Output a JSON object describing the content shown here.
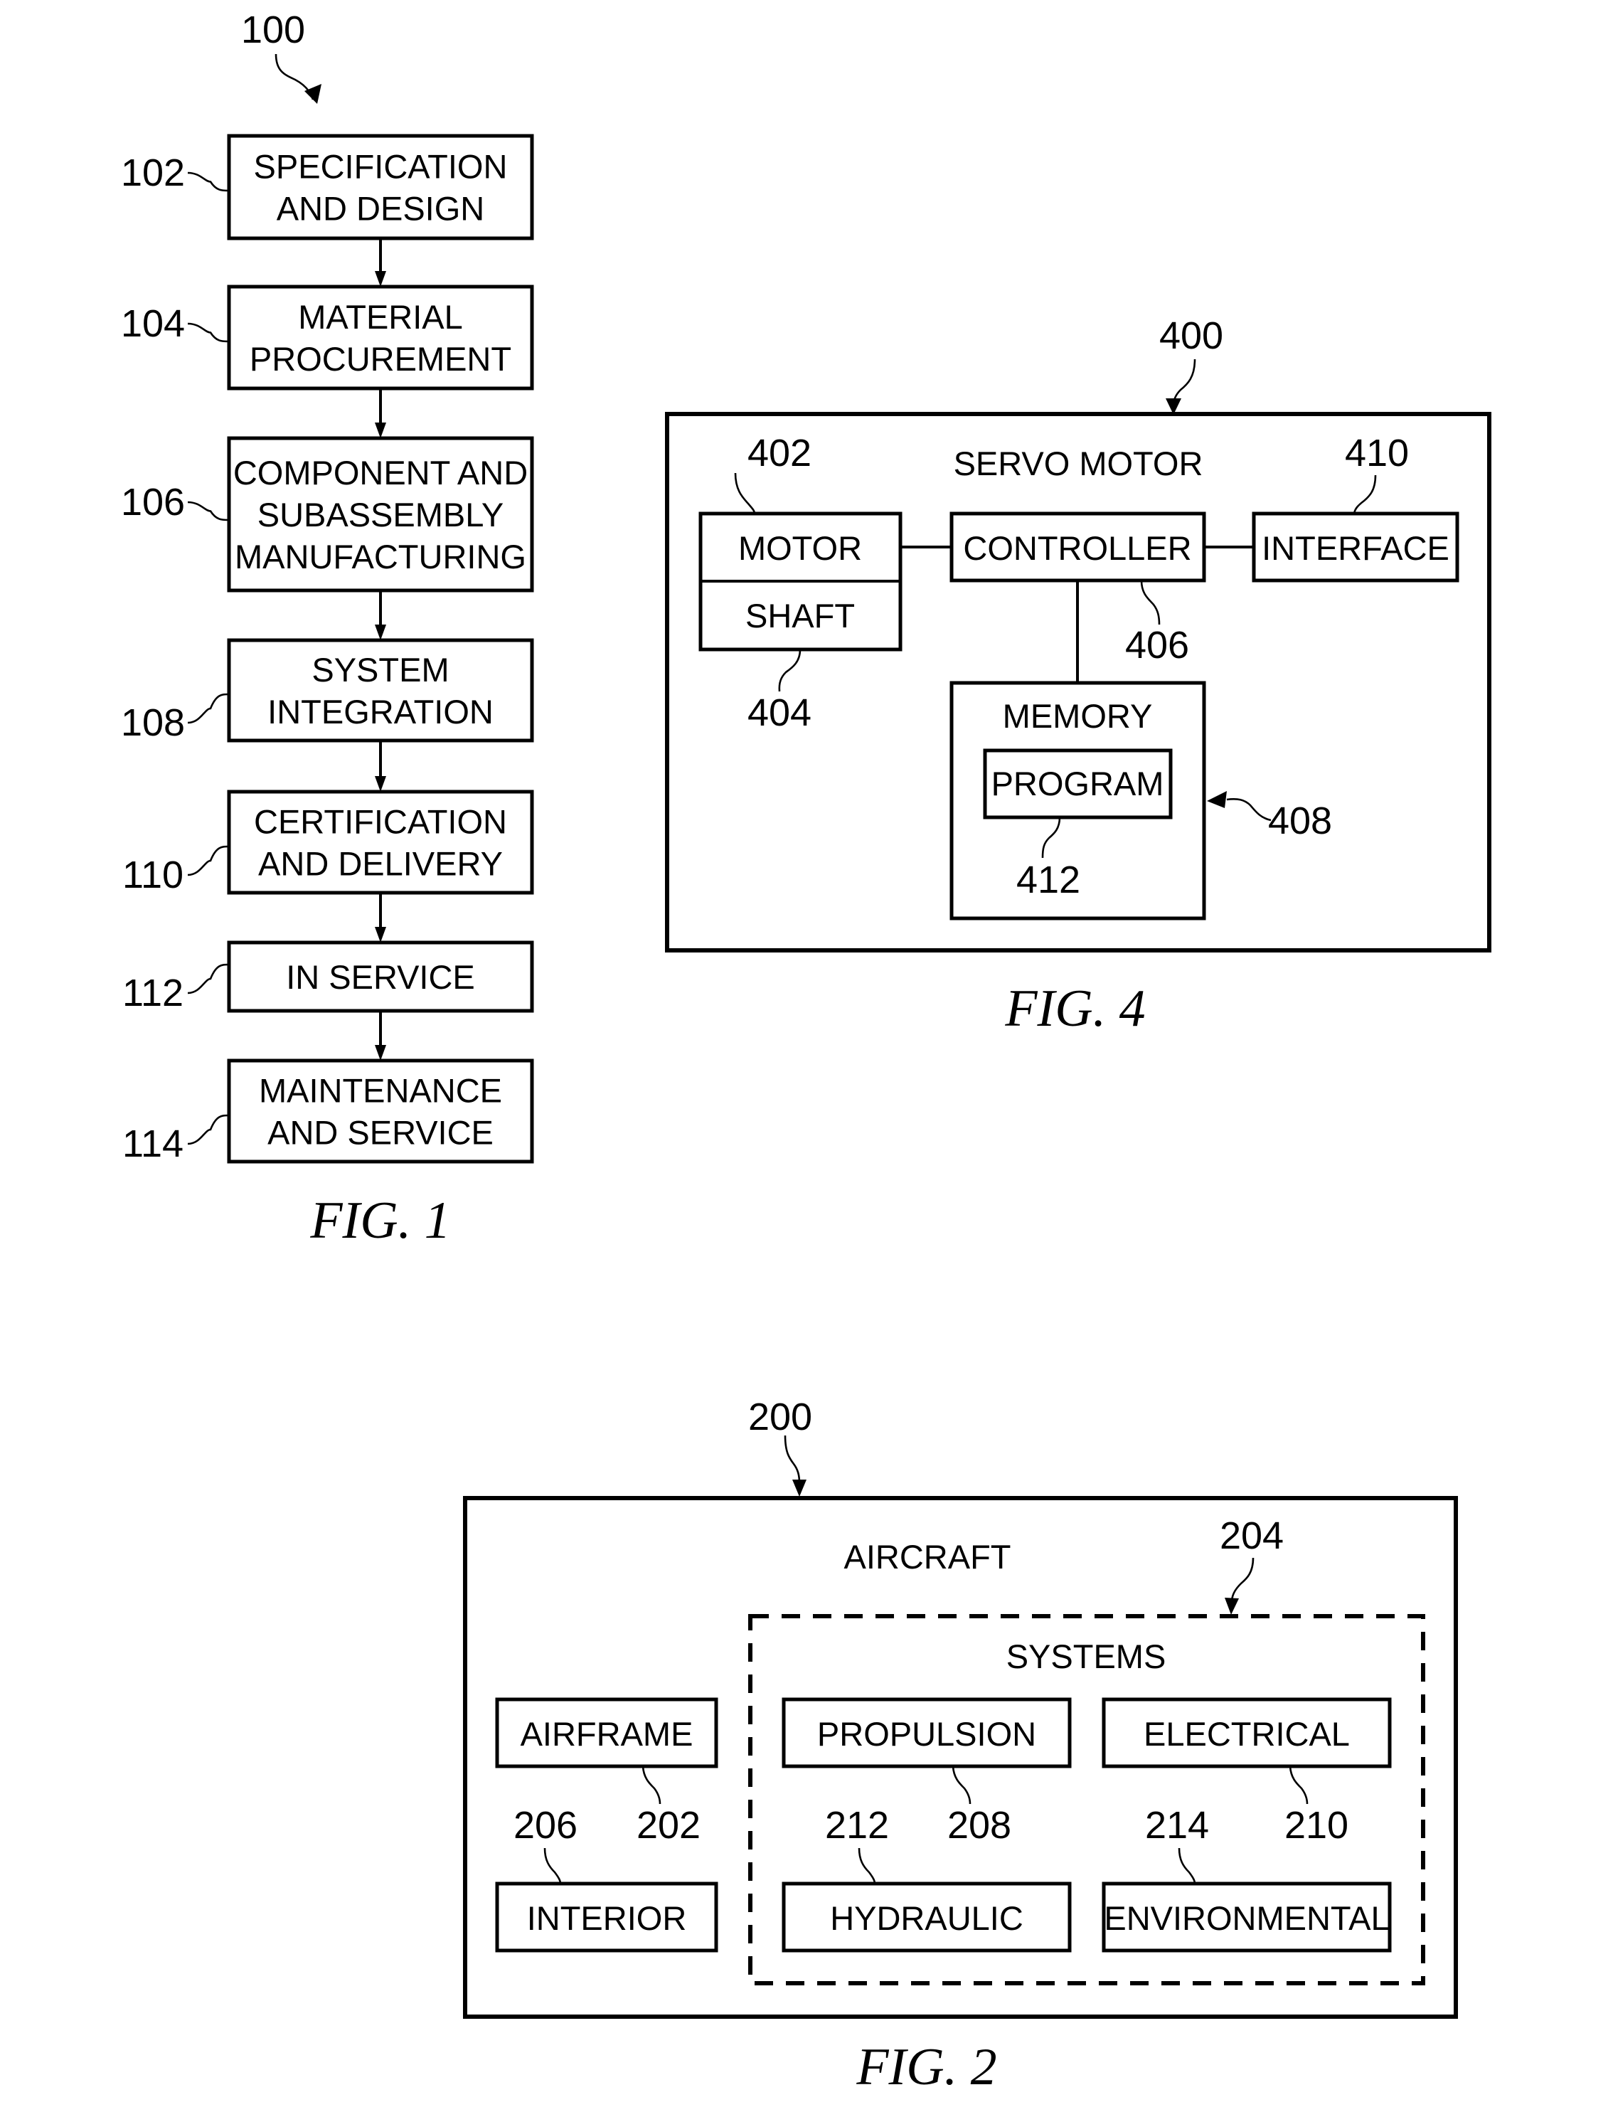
{
  "figures": {
    "fig1": {
      "caption": "FIG. 1",
      "ref": "100",
      "steps": [
        {
          "ref": "102",
          "lines": [
            "SPECIFICATION",
            "AND DESIGN"
          ]
        },
        {
          "ref": "104",
          "lines": [
            "MATERIAL",
            "PROCUREMENT"
          ]
        },
        {
          "ref": "106",
          "lines": [
            "COMPONENT AND",
            "SUBASSEMBLY",
            "MANUFACTURING"
          ]
        },
        {
          "ref": "108",
          "lines": [
            "SYSTEM",
            "INTEGRATION"
          ]
        },
        {
          "ref": "110",
          "lines": [
            "CERTIFICATION",
            "AND DELIVERY"
          ]
        },
        {
          "ref": "112",
          "lines": [
            "IN SERVICE"
          ]
        },
        {
          "ref": "114",
          "lines": [
            "MAINTENANCE",
            "AND SERVICE"
          ]
        }
      ]
    },
    "fig4": {
      "caption": "FIG. 4",
      "ref": "400",
      "title": "SERVO MOTOR",
      "motor": {
        "label": "MOTOR",
        "ref": "402"
      },
      "shaft": {
        "label": "SHAFT",
        "ref": "404"
      },
      "controller": {
        "label": "CONTROLLER",
        "ref": "406"
      },
      "interface": {
        "label": "INTERFACE",
        "ref": "410"
      },
      "memory": {
        "label": "MEMORY",
        "ref": "408"
      },
      "program": {
        "label": "PROGRAM",
        "ref": "412"
      }
    },
    "fig2": {
      "caption": "FIG. 2",
      "ref": "200",
      "title": "AIRCRAFT",
      "systems": {
        "label": "SYSTEMS",
        "ref": "204"
      },
      "airframe": {
        "label": "AIRFRAME",
        "ref": "202"
      },
      "interior": {
        "label": "INTERIOR",
        "ref": "206"
      },
      "propulsion": {
        "label": "PROPULSION",
        "ref": "208"
      },
      "electrical": {
        "label": "ELECTRICAL",
        "ref": "210"
      },
      "hydraulic": {
        "label": "HYDRAULIC",
        "ref": "212"
      },
      "environmental": {
        "label": "ENVIRONMENTAL",
        "ref": "214"
      }
    }
  }
}
